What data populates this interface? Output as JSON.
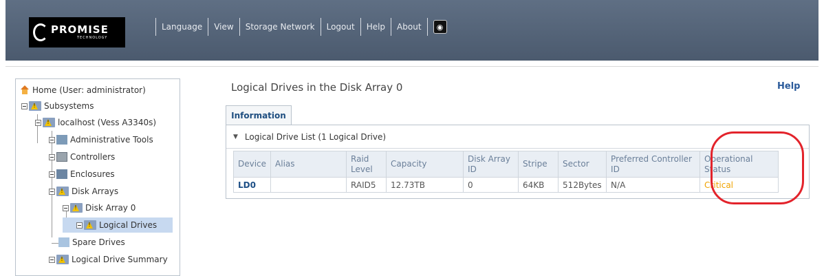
{
  "header": {
    "brand": "PROMISE",
    "brand_sub": "TECHNOLOGY",
    "nav": [
      "Language",
      "View",
      "Storage Network",
      "Logout",
      "Help",
      "About"
    ],
    "globe_icon": "globe-icon"
  },
  "sidebar": {
    "items": [
      {
        "label": "Home (User: administrator)",
        "icon": "house-icon"
      },
      {
        "label": "Subsystems",
        "icon": "subsystem-icon"
      },
      {
        "label": "localhost (Vess A3340s)",
        "icon": "subsystem-icon"
      },
      {
        "label": "Administrative Tools",
        "icon": "tools-icon"
      },
      {
        "label": "Controllers",
        "icon": "controller-icon"
      },
      {
        "label": "Enclosures",
        "icon": "enclosure-icon"
      },
      {
        "label": "Disk Arrays",
        "icon": "disk-array-icon"
      },
      {
        "label": "Disk Array 0",
        "icon": "disk-array-icon"
      },
      {
        "label": "Logical Drives",
        "icon": "logical-drive-warning-icon"
      },
      {
        "label": "Spare Drives",
        "icon": "spare-drive-icon"
      },
      {
        "label": "Logical Drive Summary",
        "icon": "logical-drive-summary-icon"
      }
    ]
  },
  "main": {
    "title": "Logical Drives in the Disk Array 0",
    "help": "Help",
    "tab": "Information",
    "panel_title": "Logical Drive List (1 Logical Drive)",
    "table": {
      "headers": [
        "Device",
        "Alias",
        "Raid Level",
        "Capacity",
        "Disk Array ID",
        "Stripe",
        "Sector",
        "Preferred Controller ID",
        "Operational Status"
      ],
      "rows": [
        [
          "LD0",
          "",
          "RAID5",
          "12.73TB",
          "0",
          "64KB",
          "512Bytes",
          "N/A",
          "Critical"
        ]
      ]
    }
  },
  "colors": {
    "header_bg": "#56667b",
    "critical": "#f0a300",
    "annotation": "#e3232b",
    "selected": "#c7d9f0"
  }
}
